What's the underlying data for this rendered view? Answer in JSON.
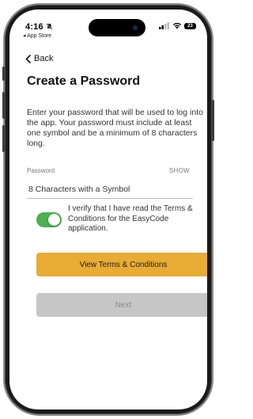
{
  "status_bar": {
    "time": "4:16",
    "back_app": "◂ App Store",
    "battery": "23"
  },
  "nav": {
    "back_label": "Back"
  },
  "page": {
    "title": "Create a Password",
    "description": "Enter your password that will be used to log into the app.  Your password must include at least one symbol and be a minimum of 8 characters long."
  },
  "password_field": {
    "label": "Password",
    "show_label": "SHOW",
    "placeholder": "8 Characters with a Symbol",
    "value": ""
  },
  "verify": {
    "toggle_on": true,
    "text": "I verify that I have read the Terms & Conditions for the EasyCode application."
  },
  "buttons": {
    "terms_label": "View Terms & Conditions",
    "next_label": "Next"
  },
  "colors": {
    "accent": "#e8ab33",
    "toggle_on": "#4caf50",
    "disabled": "#c6c6c6"
  },
  "icons": [
    "chevron-left-icon",
    "signal-icon",
    "wifi-icon",
    "battery-icon",
    "bell-slash-icon"
  ]
}
